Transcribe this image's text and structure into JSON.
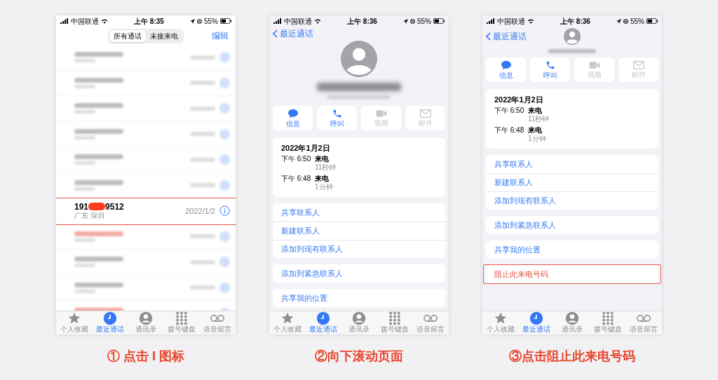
{
  "phones": [
    {
      "kind": "recents",
      "status_bar": {
        "carrier": "中国联通",
        "time": "上午 8:35",
        "battery": "55%"
      },
      "segments": [
        {
          "label": "所有通话",
          "selected": true
        },
        {
          "label": "未接来电",
          "selected": false
        }
      ],
      "edit": "编辑",
      "rows": [
        {
          "kind": "blurred",
          "missed": false
        },
        {
          "kind": "blurred",
          "missed": false
        },
        {
          "kind": "blurred",
          "missed": false
        },
        {
          "kind": "blurred",
          "missed": false
        },
        {
          "kind": "blurred",
          "missed": false
        },
        {
          "kind": "blurred",
          "missed": false
        },
        {
          "kind": "entry",
          "number_start": "191",
          "number_end": "9512",
          "location": "广东 深圳",
          "date": "2022/1/2",
          "highlighted": true
        },
        {
          "kind": "blurred",
          "missed": true
        },
        {
          "kind": "blurred",
          "missed": false
        },
        {
          "kind": "blurred",
          "missed": false
        },
        {
          "kind": "blurred",
          "missed": true
        }
      ],
      "tab_bar": [
        {
          "label": "个人收藏",
          "kind": "star",
          "selected": false
        },
        {
          "label": "最近通话",
          "kind": "clock",
          "selected": true
        },
        {
          "label": "通讯录",
          "kind": "person",
          "selected": false
        },
        {
          "label": "拨号键盘",
          "kind": "keypad",
          "selected": false
        },
        {
          "label": "语音留言",
          "kind": "voicemail",
          "selected": false
        }
      ]
    },
    {
      "kind": "detail_top",
      "status_bar": {
        "carrier": "中国联通",
        "time": "上午 8:36",
        "battery": "55%"
      },
      "back": "最近通话",
      "actions": [
        {
          "label": "信息",
          "kind": "message",
          "enabled": true
        },
        {
          "label": "呼叫",
          "kind": "phone",
          "enabled": true
        },
        {
          "label": "视频",
          "kind": "video",
          "enabled": false
        },
        {
          "label": "邮件",
          "kind": "mail",
          "enabled": false
        }
      ],
      "log": {
        "date": "2022年1月2日",
        "calls": [
          {
            "time": "下午 6:50",
            "type": "来电",
            "duration": "11秒钟"
          },
          {
            "time": "下午 6:48",
            "type": "来电",
            "duration": "1分钟"
          }
        ]
      },
      "groups": [
        [
          {
            "label": "共享联系人",
            "destructive": false,
            "highlighted": false
          },
          {
            "label": "新建联系人",
            "destructive": false,
            "highlighted": false
          },
          {
            "label": "添加到现有联系人",
            "destructive": false,
            "highlighted": false
          }
        ],
        [
          {
            "label": "添加到紧急联系人",
            "destructive": false,
            "highlighted": false
          }
        ],
        [
          {
            "label": "共享我的位置",
            "destructive": false,
            "highlighted": false
          }
        ]
      ],
      "tab_bar": [
        {
          "label": "个人收藏",
          "kind": "star",
          "selected": false
        },
        {
          "label": "最近通话",
          "kind": "clock",
          "selected": true
        },
        {
          "label": "通讯录",
          "kind": "person",
          "selected": false
        },
        {
          "label": "拨号键盘",
          "kind": "keypad",
          "selected": false
        },
        {
          "label": "语音留言",
          "kind": "voicemail",
          "selected": false
        }
      ]
    },
    {
      "kind": "detail_scrolled",
      "status_bar": {
        "carrier": "中国联通",
        "time": "上午 8:36",
        "battery": "55%"
      },
      "back": "最近通话",
      "actions": [
        {
          "label": "信息",
          "kind": "message",
          "enabled": true
        },
        {
          "label": "呼叫",
          "kind": "phone",
          "enabled": true
        },
        {
          "label": "视频",
          "kind": "video",
          "enabled": false
        },
        {
          "label": "邮件",
          "kind": "mail",
          "enabled": false
        }
      ],
      "log": {
        "date": "2022年1月2日",
        "calls": [
          {
            "time": "下午 6:50",
            "type": "来电",
            "duration": "11秒钟"
          },
          {
            "time": "下午 6:48",
            "type": "来电",
            "duration": "1分钟"
          }
        ]
      },
      "groups": [
        [
          {
            "label": "共享联系人",
            "destructive": false,
            "highlighted": false
          },
          {
            "label": "新建联系人",
            "destructive": false,
            "highlighted": false
          },
          {
            "label": "添加到现有联系人",
            "destructive": false,
            "highlighted": false
          }
        ],
        [
          {
            "label": "添加到紧急联系人",
            "destructive": false,
            "highlighted": false
          }
        ],
        [
          {
            "label": "共享我的位置",
            "destructive": false,
            "highlighted": false
          }
        ],
        [
          {
            "label": "阻止此来电号码",
            "destructive": true,
            "highlighted": true
          }
        ]
      ],
      "tab_bar": [
        {
          "label": "个人收藏",
          "kind": "star",
          "selected": false
        },
        {
          "label": "最近通话",
          "kind": "clock",
          "selected": true
        },
        {
          "label": "通讯录",
          "kind": "person",
          "selected": false
        },
        {
          "label": "拨号键盘",
          "kind": "keypad",
          "selected": false
        },
        {
          "label": "语音留言",
          "kind": "voicemail",
          "selected": false
        }
      ]
    }
  ],
  "captions": [
    "① 点击 I 图标",
    "②向下滚动页面",
    "③点击阻止此来电号码"
  ]
}
